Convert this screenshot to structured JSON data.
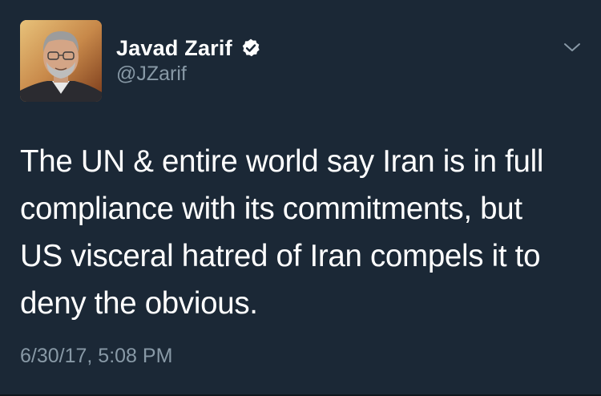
{
  "user": {
    "display_name": "Javad Zarif",
    "handle": "@JZarif",
    "verified": true,
    "avatar": "profile-photo"
  },
  "tweet": {
    "text_lines": [
      "The UN & entire world say Iran is in full",
      "compliance with its commitments, but",
      "US visceral hatred of Iran compels it to",
      "deny the obvious."
    ],
    "timestamp": "6/30/17, 5:08 PM"
  },
  "icons": {
    "verified": "verified-badge-icon",
    "menu": "chevron-down-icon"
  },
  "colors": {
    "background": "#1b2836",
    "text_primary": "#ffffff",
    "text_secondary": "#8899a6"
  }
}
